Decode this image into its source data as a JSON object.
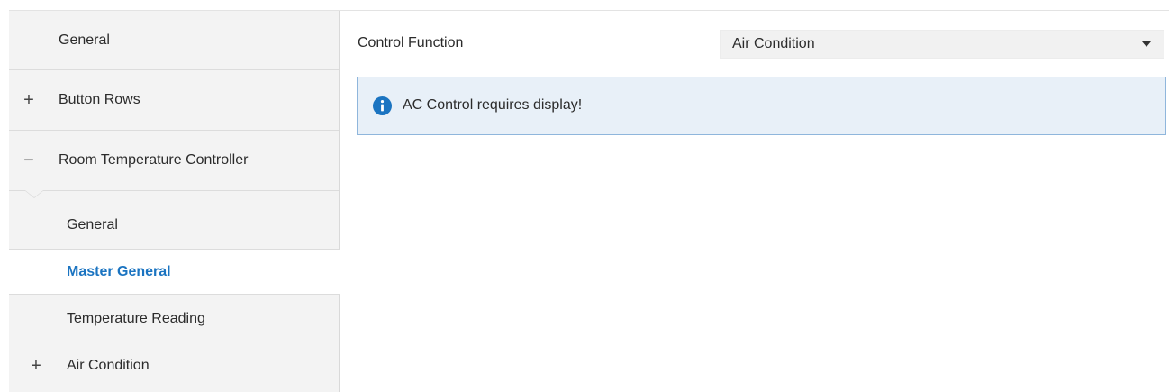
{
  "sidebar": {
    "items": [
      {
        "label": "General",
        "sign": ""
      },
      {
        "label": "Button Rows",
        "sign": "+"
      },
      {
        "label": "Room Temperature Controller",
        "sign": "−"
      },
      {
        "label": "General",
        "sign": ""
      },
      {
        "label": "Master General",
        "sign": "",
        "selected": true
      },
      {
        "label": "Temperature Reading",
        "sign": ""
      },
      {
        "label": "Air Condition",
        "sign": "+"
      }
    ]
  },
  "main": {
    "control_function_label": "Control Function",
    "control_function_value": "Air Condition",
    "info_message": "AC Control requires display!",
    "info_icon": "info-circle-icon"
  },
  "colors": {
    "accent": "#1b74c1",
    "info_bg": "#e8f0f8",
    "info_border": "#8fb6dc",
    "sidebar_bg": "#f3f3f3"
  }
}
